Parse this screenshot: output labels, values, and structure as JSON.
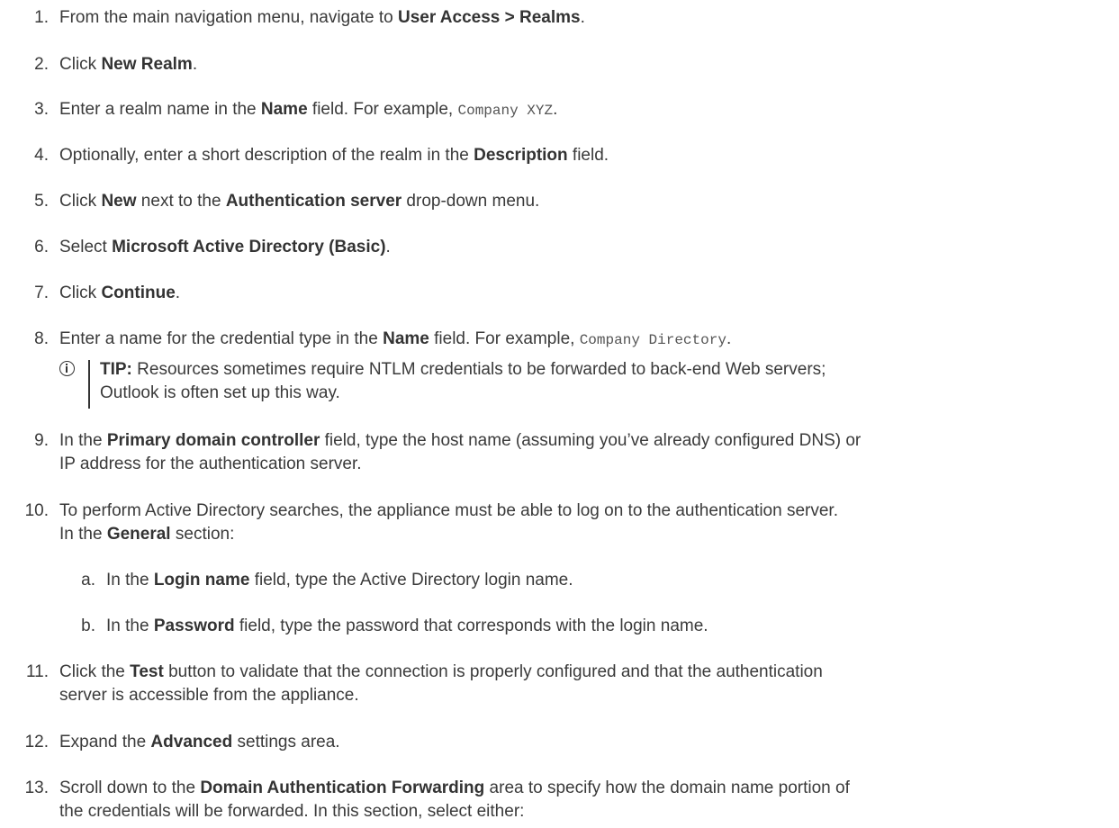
{
  "steps": [
    {
      "num": "1.",
      "t1": "From the main navigation menu, navigate to ",
      "b1": "User Access > Realms",
      "t2": "."
    },
    {
      "num": "2.",
      "t1": "Click ",
      "b1": "New Realm",
      "t2": "."
    },
    {
      "num": "3.",
      "t1": "Enter a realm name in the ",
      "b1": "Name",
      "t2": " field. For example, ",
      "code": "Company XYZ",
      "t3": "."
    },
    {
      "num": "4.",
      "t1": "Optionally, enter a short description of the realm in the ",
      "b1": "Description",
      "t2": " field."
    },
    {
      "num": "5.",
      "t1": "Click ",
      "b1": "New",
      "t2": " next to the ",
      "b2": "Authentication server",
      "t3": " drop-down menu."
    },
    {
      "num": "6.",
      "t1": "Select ",
      "b1": "Microsoft Active Directory (Basic)",
      "t2": "."
    },
    {
      "num": "7.",
      "t1": "Click ",
      "b1": "Continue",
      "t2": "."
    },
    {
      "num": "8.",
      "t1": "Enter a name for the credential type in the ",
      "b1": "Name",
      "t2": " field. For example, ",
      "code": "Company Directory",
      "t3": "."
    },
    {
      "num": "9.",
      "t1": "In the ",
      "b1": "Primary domain controller",
      "t2": " field, type the host name (assuming you’ve already configured DNS) or",
      "line2": "IP address for the authentication server."
    },
    {
      "num": "10.",
      "t1": "To perform Active Directory searches, the appliance must be able to log on to the authentication server.",
      "l2a": "In the ",
      "l2b": "General",
      "l2c": " section:"
    },
    {
      "num": "11.",
      "t1": "Click the ",
      "b1": "Test",
      "t2": " button to validate that the connection is properly configured and that the authentication",
      "line2": "server is accessible from the appliance."
    },
    {
      "num": "12.",
      "t1": "Expand the ",
      "b1": "Advanced",
      "t2": " settings area."
    },
    {
      "num": "13.",
      "t1": "Scroll down to the ",
      "b1": "Domain Authentication Forwarding",
      "t2": " area to specify how the domain name portion of",
      "line2": "the credentials will be forwarded. In this section, select either:"
    }
  ],
  "substeps": [
    {
      "num": "a.",
      "t1": "In the ",
      "b1": "Login name",
      "t2": " field, type the Active Directory login name."
    },
    {
      "num": "b.",
      "t1": "In the ",
      "b1": "Password",
      "t2": " field, type the password that corresponds with the login name."
    }
  ],
  "tip": {
    "icon": "info-icon",
    "label": "TIP:",
    "line1": " Resources sometimes require NTLM credentials to be forwarded to back-end Web servers;",
    "line2": "Outlook is often set up this way."
  }
}
